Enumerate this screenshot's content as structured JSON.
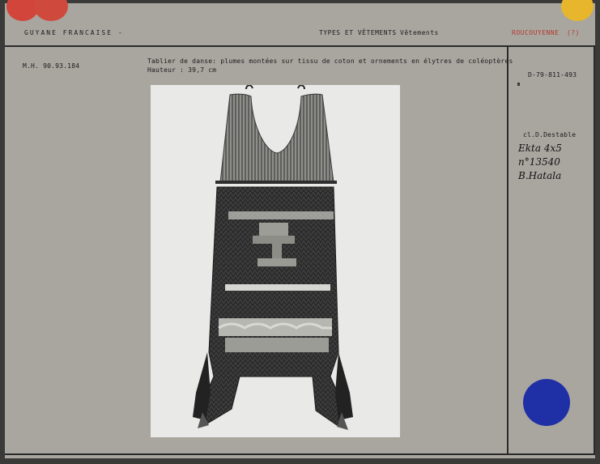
{
  "header": {
    "left_title": "GUYANE FRANCAISE -",
    "center_category": "TYPES ET VÊTEMENTS",
    "center_subcategory": "Vêtements",
    "right_group": "ROUCOUYENNE",
    "right_note": "(?)"
  },
  "record": {
    "inventory_number": "M.H. 90.93.184",
    "description": "Tablier de danse: plumes montées sur tissu de coton  et ornements en élytres de coléoptères",
    "height_line": "Hauteur : 39,7 cm"
  },
  "side_panel": {
    "photo_ref": "D-79-811-493",
    "credit": "cl.D.Destable",
    "handwritten_lines": [
      "Ekta 4x5",
      "n°13540",
      "B.Hatala"
    ]
  },
  "colors": {
    "card": "#a9a6a0",
    "frame_ink": "#2a2a2a",
    "red_dots": "#d2453a",
    "yellow_dot": "#e7b62c",
    "blue_dot": "#1f2fa6",
    "photo_background": "#e9e9e7"
  }
}
